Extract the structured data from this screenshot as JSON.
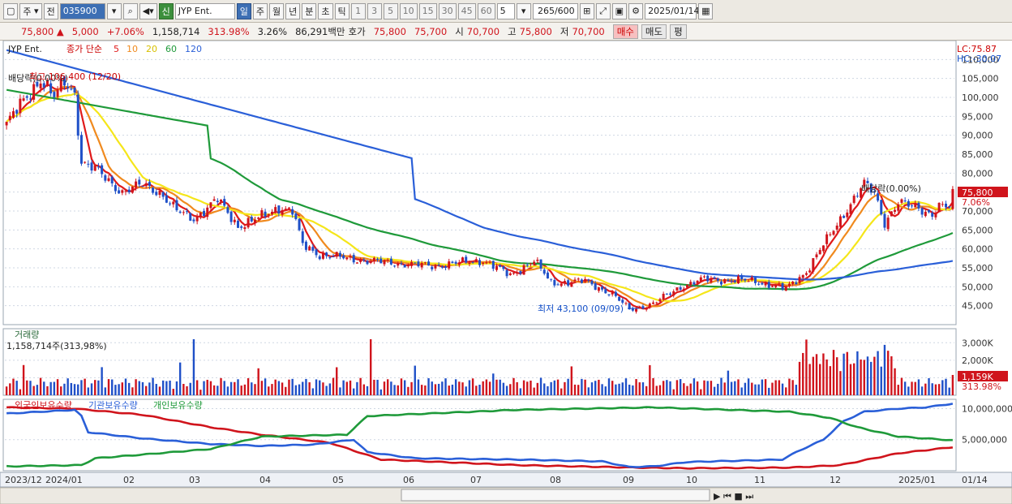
{
  "toolbar": {
    "market": "주",
    "prev": "전",
    "code": "035900",
    "badge": "신",
    "name": "JYP Ent.",
    "periods": [
      "일",
      "주",
      "월",
      "년",
      "분",
      "초",
      "틱"
    ],
    "active_period": "일",
    "intervals": [
      "1",
      "3",
      "5",
      "10",
      "15",
      "30",
      "45",
      "60"
    ],
    "interval_value": "5",
    "count": "265/600",
    "date": "2025/01/14"
  },
  "info": {
    "price": "75,800",
    "change": "5,000",
    "change_pct": "+7.06%",
    "volume": "1,158,714",
    "volume_ratio": "313.98%",
    "turnover": "3.26%",
    "amount": "86,291백만",
    "quote_label": "호가",
    "ask": "75,800",
    "bid": "75,700",
    "open_label": "시",
    "open": "70,700",
    "high_label": "고",
    "high": "75,800",
    "low_label": "저",
    "low": "70,700",
    "buy": "매수",
    "sell": "매도",
    "eval": "평"
  },
  "colors": {
    "up": "#d0141c",
    "down": "#1f50c8",
    "ma5": "#e01a1a",
    "ma10": "#f08a1e",
    "ma20": "#f5e61a",
    "ma60": "#1f9a3a",
    "ma120": "#2a5fd8",
    "foreign": "#d0141c",
    "inst": "#2a5fd8",
    "retail": "#1f9a3a",
    "grid": "#cfd7e3"
  },
  "chart_data": [
    {
      "type": "candlestick",
      "title": "JYP Ent.",
      "legend": [
        "종가 단순",
        "5",
        "10",
        "20",
        "60",
        "120"
      ],
      "ylim": [
        40000,
        115000
      ],
      "y_ticks": [
        "110,000",
        "105,000",
        "100,000",
        "95,000",
        "90,000",
        "85,000",
        "80,000",
        "75,000",
        "70,000",
        "65,000",
        "60,000",
        "55,000",
        "50,000",
        "45,000"
      ],
      "x_labels": [
        "2023/12",
        "2024/01",
        "02",
        "03",
        "04",
        "05",
        "06",
        "07",
        "08",
        "09",
        "10",
        "11",
        "12",
        "2025/01",
        "01/14"
      ],
      "last_price_label": "75,800",
      "last_pct_label": "7.06%",
      "lc_label": "LC:75.87",
      "hc_label": "HC:-30.07",
      "annotations": [
        "배당락(0.00%)",
        "최고 106,400 (12/20)",
        "최저 43,100 (09/09)",
        "배당락(0.00%)"
      ],
      "anchors": [
        [
          0,
          93000
        ],
        [
          10,
          105000
        ],
        [
          14,
          100000
        ],
        [
          17,
          104000
        ],
        [
          20,
          101000
        ],
        [
          22,
          83000
        ],
        [
          26,
          81000
        ],
        [
          34,
          75000
        ],
        [
          40,
          77000
        ],
        [
          45,
          75000
        ],
        [
          50,
          70000
        ],
        [
          55,
          68000
        ],
        [
          62,
          73000
        ],
        [
          68,
          66000
        ],
        [
          74,
          68000
        ],
        [
          80,
          71000
        ],
        [
          84,
          70000
        ],
        [
          87,
          61000
        ],
        [
          92,
          58500
        ],
        [
          100,
          57500
        ],
        [
          110,
          56500
        ],
        [
          125,
          55500
        ],
        [
          140,
          57000
        ],
        [
          148,
          53000
        ],
        [
          155,
          57000
        ],
        [
          160,
          51000
        ],
        [
          170,
          51500
        ],
        [
          178,
          48000
        ],
        [
          183,
          44000
        ],
        [
          190,
          45500
        ],
        [
          198,
          50000
        ],
        [
          205,
          52000
        ],
        [
          220,
          51500
        ],
        [
          229,
          49500
        ],
        [
          235,
          54000
        ],
        [
          245,
          68000
        ],
        [
          252,
          77000
        ],
        [
          255,
          75000
        ],
        [
          258,
          67000
        ],
        [
          262,
          72000
        ],
        [
          268,
          71000
        ],
        [
          272,
          69000
        ],
        [
          274,
          71000
        ],
        [
          277,
          71000
        ],
        [
          278,
          75800
        ]
      ]
    },
    {
      "type": "bar",
      "title": "거래량",
      "value_label": "1,158,714주(313,98%)",
      "y_ticks": [
        "3,000K",
        "2,000K",
        "1,000K"
      ],
      "ylim": [
        0,
        3800
      ],
      "last_value_label": "1,159K",
      "last_pct_label": "313.98%"
    },
    {
      "type": "line",
      "legend": [
        "외국인보유수량",
        "기관보유수량",
        "개인보유수량"
      ],
      "y_ticks": [
        "10,000,000",
        "5,000,000"
      ],
      "ylim": [
        0,
        11500000
      ],
      "series": [
        {
          "name": "외국인보유수량",
          "anchors": [
            [
              0,
              10200000
            ],
            [
              20,
              10000000
            ],
            [
              40,
              9000000
            ],
            [
              60,
              7000000
            ],
            [
              75,
              5800000
            ],
            [
              95,
              4500000
            ],
            [
              110,
              1800000
            ],
            [
              150,
              900000
            ],
            [
              185,
              500000
            ],
            [
              200,
              400000
            ],
            [
              230,
              500000
            ],
            [
              245,
              900000
            ],
            [
              262,
              2800000
            ],
            [
              278,
              3800000
            ]
          ]
        },
        {
          "name": "기관보유수량",
          "anchors": [
            [
              0,
              9200000
            ],
            [
              20,
              9800000
            ],
            [
              22,
              8800000
            ],
            [
              24,
              6200000
            ],
            [
              40,
              5200000
            ],
            [
              60,
              4300000
            ],
            [
              75,
              4000000
            ],
            [
              90,
              4200000
            ],
            [
              102,
              5000000
            ],
            [
              106,
              3000000
            ],
            [
              120,
              2000000
            ],
            [
              150,
              1800000
            ],
            [
              175,
              1500000
            ],
            [
              183,
              600000
            ],
            [
              190,
              700000
            ],
            [
              200,
              1400000
            ],
            [
              228,
              1800000
            ],
            [
              232,
              3000000
            ],
            [
              240,
              5000000
            ],
            [
              246,
              8000000
            ],
            [
              252,
              9500000
            ],
            [
              262,
              10000000
            ],
            [
              270,
              10200000
            ],
            [
              278,
              10800000
            ]
          ]
        },
        {
          "name": "개인보유수량",
          "anchors": [
            [
              0,
              700000
            ],
            [
              22,
              900000
            ],
            [
              26,
              2000000
            ],
            [
              40,
              2600000
            ],
            [
              60,
              3500000
            ],
            [
              75,
              5500000
            ],
            [
              100,
              5800000
            ],
            [
              106,
              8800000
            ],
            [
              150,
              9800000
            ],
            [
              190,
              10200000
            ],
            [
              230,
              9500000
            ],
            [
              242,
              8500000
            ],
            [
              250,
              7000000
            ],
            [
              262,
              5500000
            ],
            [
              278,
              4900000
            ]
          ]
        }
      ]
    }
  ]
}
